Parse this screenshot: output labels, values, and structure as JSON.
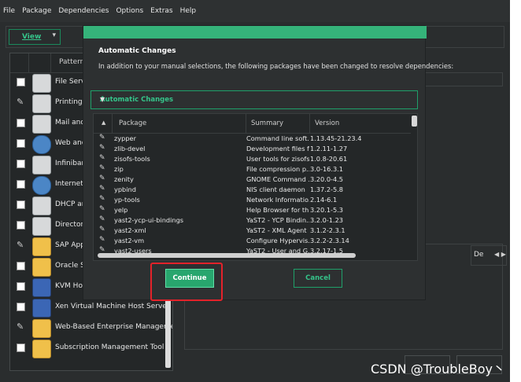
{
  "menubar": {
    "items": [
      "File",
      "Package",
      "Dependencies",
      "Options",
      "Extras",
      "Help"
    ]
  },
  "toolbar": {
    "view_label": "View"
  },
  "left_panel": {
    "header": "Pattern",
    "rows": [
      {
        "label": "File Serve",
        "icon": "file-server-icon",
        "state": "unchecked"
      },
      {
        "label": "Printing",
        "icon": "printer-icon",
        "state": "installed"
      },
      {
        "label": "Mail and",
        "icon": "mail-icon",
        "state": "unchecked"
      },
      {
        "label": "Web and",
        "icon": "web-icon",
        "state": "unchecked"
      },
      {
        "label": "Infiniband",
        "icon": "network-card-icon",
        "state": "unchecked"
      },
      {
        "label": "Internet G",
        "icon": "globe-icon",
        "state": "unchecked"
      },
      {
        "label": "DHCP an",
        "icon": "dhcp-icon",
        "state": "unchecked"
      },
      {
        "label": "Directory",
        "icon": "directory-icon",
        "state": "unchecked"
      },
      {
        "label": "SAP Appl",
        "icon": "package-icon",
        "state": "installed"
      },
      {
        "label": "Oracle Se",
        "icon": "package-icon",
        "state": "unchecked"
      },
      {
        "label": "KVM Hos",
        "icon": "monitor-icon",
        "state": "unchecked"
      },
      {
        "label": "Xen Virtual Machine Host Server",
        "icon": "monitor-icon",
        "state": "unchecked"
      },
      {
        "label": "Web-Based Enterprise Management",
        "icon": "package-icon",
        "state": "installed"
      },
      {
        "label": "Subscription Management Tool",
        "icon": "package-icon",
        "state": "unchecked"
      }
    ]
  },
  "right_area": {
    "tab_label": "De"
  },
  "dialog": {
    "title": "Automatic Changes",
    "description": "In addition to your manual selections, the following packages have been changed to resolve dependencies:",
    "combo_value": "Automatic Changes",
    "columns": {
      "package": "Package",
      "summary": "Summary",
      "version": "Version"
    },
    "rows": [
      {
        "package": "zypper",
        "summary": "Command line soft...",
        "version": "1.13.45-21.23.4"
      },
      {
        "package": "zlib-devel",
        "summary": "Development files f...",
        "version": "1.2.11-1.27"
      },
      {
        "package": "zisofs-tools",
        "summary": "User tools for zisofs",
        "version": "1.0.8-20.61"
      },
      {
        "package": "zip",
        "summary": "File compression p...",
        "version": "3.0-16.3.1"
      },
      {
        "package": "zenity",
        "summary": "GNOME Command ...",
        "version": "3.20.0-4.5"
      },
      {
        "package": "ypbind",
        "summary": "NIS client daemon",
        "version": "1.37.2-5.8"
      },
      {
        "package": "yp-tools",
        "summary": "Network Informatio...",
        "version": "2.14-6.1"
      },
      {
        "package": "yelp",
        "summary": "Help Browser for th...",
        "version": "3.20.1-5.3"
      },
      {
        "package": "yast2-ycp-ui-bindings",
        "summary": "YaST2 - YCP Bindin...",
        "version": "3.2.0-1.23"
      },
      {
        "package": "yast2-xml",
        "summary": "YaST2 - XML Agent",
        "version": "3.1.2-2.3.1"
      },
      {
        "package": "yast2-vm",
        "summary": "Configure Hypervis...",
        "version": "3.2.2-2.3.14"
      },
      {
        "package": "yast2-users",
        "summary": "YaST2 - User and G...",
        "version": "3.2.17-1.5"
      }
    ],
    "continue_label": "Continue",
    "cancel_label": "Cancel"
  },
  "bottom_buttons": [
    "",
    ""
  ],
  "watermark": "CSDN @TroubleBoy丶"
}
